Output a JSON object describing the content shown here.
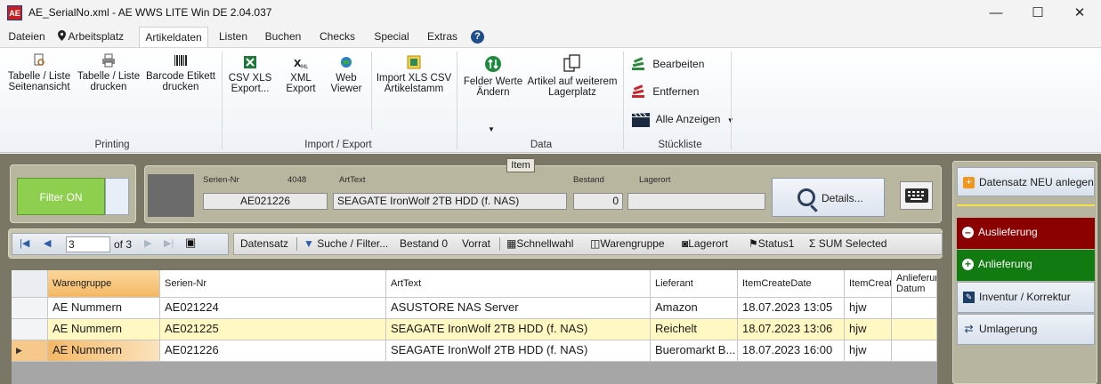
{
  "window": {
    "title": "AE_SerialNo.xml - AE WWS LITE Win DE 2.04.037",
    "app_icon_text": "AE",
    "minimize": "—",
    "maximize": "☐",
    "close": "✕"
  },
  "menu": {
    "tabs": [
      "Dateien",
      "Arbeitsplatz",
      "Artikeldaten",
      "Listen",
      "Buchen",
      "Checks",
      "Special",
      "Extras"
    ],
    "active": "Artikeldaten",
    "help": "?"
  },
  "ribbon": {
    "printing": {
      "label": "Printing",
      "buttons": [
        "Tabelle / Liste\nSeitenansicht",
        "Tabelle / Liste\ndrucken",
        "Barcode Etikett\ndrucken"
      ]
    },
    "import_export": {
      "label": "Import / Export",
      "buttons": [
        "CSV XLS\nExport...",
        "XML\nExport",
        "Web\nViewer",
        "Import XLS CSV\nArtikelstamm"
      ]
    },
    "data": {
      "label": "Data",
      "buttons": [
        "Felder Werte\nÄndern",
        "Artikel auf weiterem\nLagerplatz"
      ]
    },
    "stueckliste": {
      "label": "Stückliste",
      "buttons": [
        "Bearbeiten",
        "Entfernen",
        "Alle Anzeigen"
      ]
    }
  },
  "filter": {
    "label": "Filter ON"
  },
  "item": {
    "group_label": "Item",
    "serien_nr_label": "Serien-Nr",
    "count": "4048",
    "arttext_label": "ArtText",
    "bestand_label": "Bestand",
    "lagerort_label": "Lagerort",
    "serien_nr": "AE021226",
    "arttext": "SEAGATE IronWolf 2TB HDD (f. NAS)",
    "bestand": "0",
    "lagerort": ""
  },
  "details_button": "Details...",
  "navigator": {
    "current": "3",
    "of_label": "of 3"
  },
  "toolbar": [
    "Datensatz",
    "Suche / Filter...",
    "Bestand 0",
    "Vorrat",
    "Schnellwahl",
    "Warengruppe",
    "Lagerort",
    "Status1",
    "SUM Selected"
  ],
  "grid": {
    "columns": [
      "Warengruppe",
      "Serien-Nr",
      "ArtText",
      "Lieferant",
      "ItemCreateDate",
      "ItemCreat",
      "Anlieferun\nDatum"
    ],
    "rows": [
      [
        "AE Nummern",
        "AE021224",
        "ASUSTORE NAS Server",
        "Amazon",
        "18.07.2023 13:05",
        "hjw",
        ""
      ],
      [
        "AE Nummern",
        "AE021225",
        "SEAGATE IronWolf 2TB HDD (f. NAS)",
        "Reichelt",
        "18.07.2023 13:06",
        "hjw",
        ""
      ],
      [
        "AE Nummern",
        "AE021226",
        "SEAGATE IronWolf 2TB HDD (f. NAS)",
        "Bueromarkt B...",
        "18.07.2023 16:00",
        "hjw",
        ""
      ]
    ],
    "current_row_index": 2
  },
  "actions": {
    "new": "Datensatz NEU anlegen",
    "auslieferung": "Auslieferung",
    "anlieferung": "Anlieferung",
    "inventur": "Inventur / Korrektur",
    "umlagerung": "Umlagerung"
  },
  "colors": {
    "dark_bg": "#7b7766",
    "panel_bg": "#b9b69f",
    "filter_green": "#8fcf4f",
    "auslieferung_red": "#8b0000",
    "anlieferung_green": "#117a11",
    "row_highlight": "#fff8c2",
    "header_highlight": "#f4b866"
  }
}
